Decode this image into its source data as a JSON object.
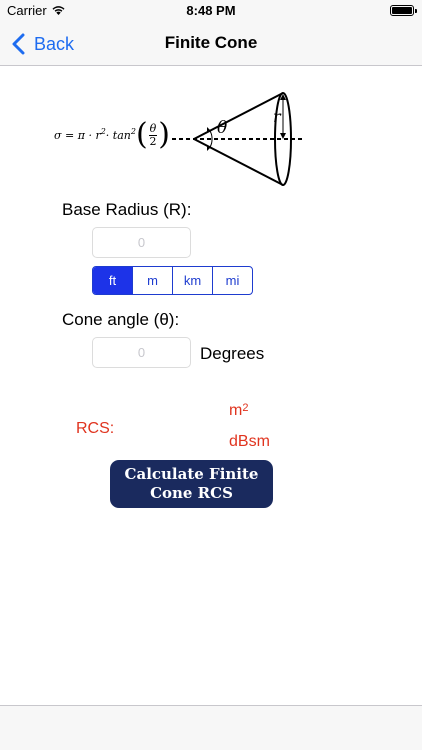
{
  "status_bar": {
    "carrier": "Carrier",
    "time": "8:48 PM"
  },
  "nav": {
    "back_label": "Back",
    "title": "Finite Cone"
  },
  "formula": {
    "sigma": "σ = π · r",
    "exp": "2",
    "tan": " · tan",
    "tan_exp": "2",
    "frac_num": "θ",
    "frac_den": "2",
    "cone_theta": "θ",
    "cone_r": "r"
  },
  "base_radius": {
    "label": "Base Radius (R):",
    "placeholder": "0"
  },
  "units": {
    "options": [
      "ft",
      "m",
      "km",
      "mi"
    ],
    "selected": "ft"
  },
  "cone_angle": {
    "label": "Cone angle (θ):",
    "placeholder": "0",
    "unit": "Degrees"
  },
  "results": {
    "rcs_label": "RCS:",
    "unit_m2_base": "m",
    "unit_m2_exp": "2",
    "unit_dbsm": "dBsm"
  },
  "calculate_button": {
    "line1": "Calculate Finite",
    "line2": "Cone RCS"
  },
  "colors": {
    "accent": "#1e6cf0",
    "segment_selected": "#1d33e8",
    "result_red": "#e0341f",
    "button_bg": "#1a2a5e"
  }
}
